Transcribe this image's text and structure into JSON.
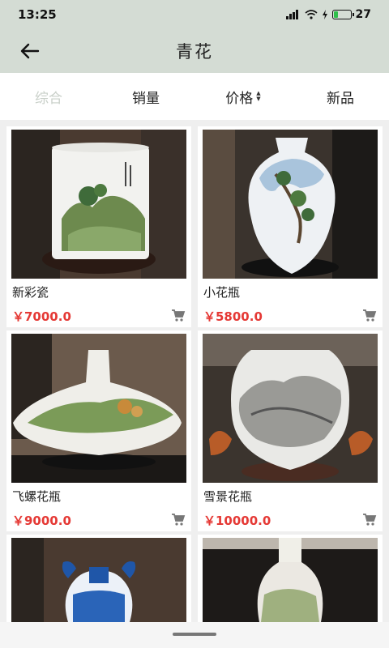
{
  "status_bar": {
    "time": "13:25",
    "battery": "27",
    "battery_fraction": 0.27
  },
  "header": {
    "title": "青花"
  },
  "tabs": [
    {
      "label": "综合",
      "active": true
    },
    {
      "label": "销量",
      "active": false
    },
    {
      "label": "价格",
      "active": false,
      "icon": "sort-updown-icon"
    },
    {
      "label": "新品",
      "active": false
    }
  ],
  "products": [
    {
      "name": "新彩瓷",
      "price": "￥7000.0"
    },
    {
      "name": "小花瓶",
      "price": "￥5800.0"
    },
    {
      "name": "飞螺花瓶",
      "price": "￥9000.0"
    },
    {
      "name": "雪景花瓶",
      "price": "￥10000.0"
    },
    {
      "name": "",
      "price": ""
    },
    {
      "name": "",
      "price": ""
    }
  ],
  "colors": {
    "accent_price": "#e53935",
    "header_bg": "#d4dcd4",
    "active_tab": "#c9d0c9"
  }
}
